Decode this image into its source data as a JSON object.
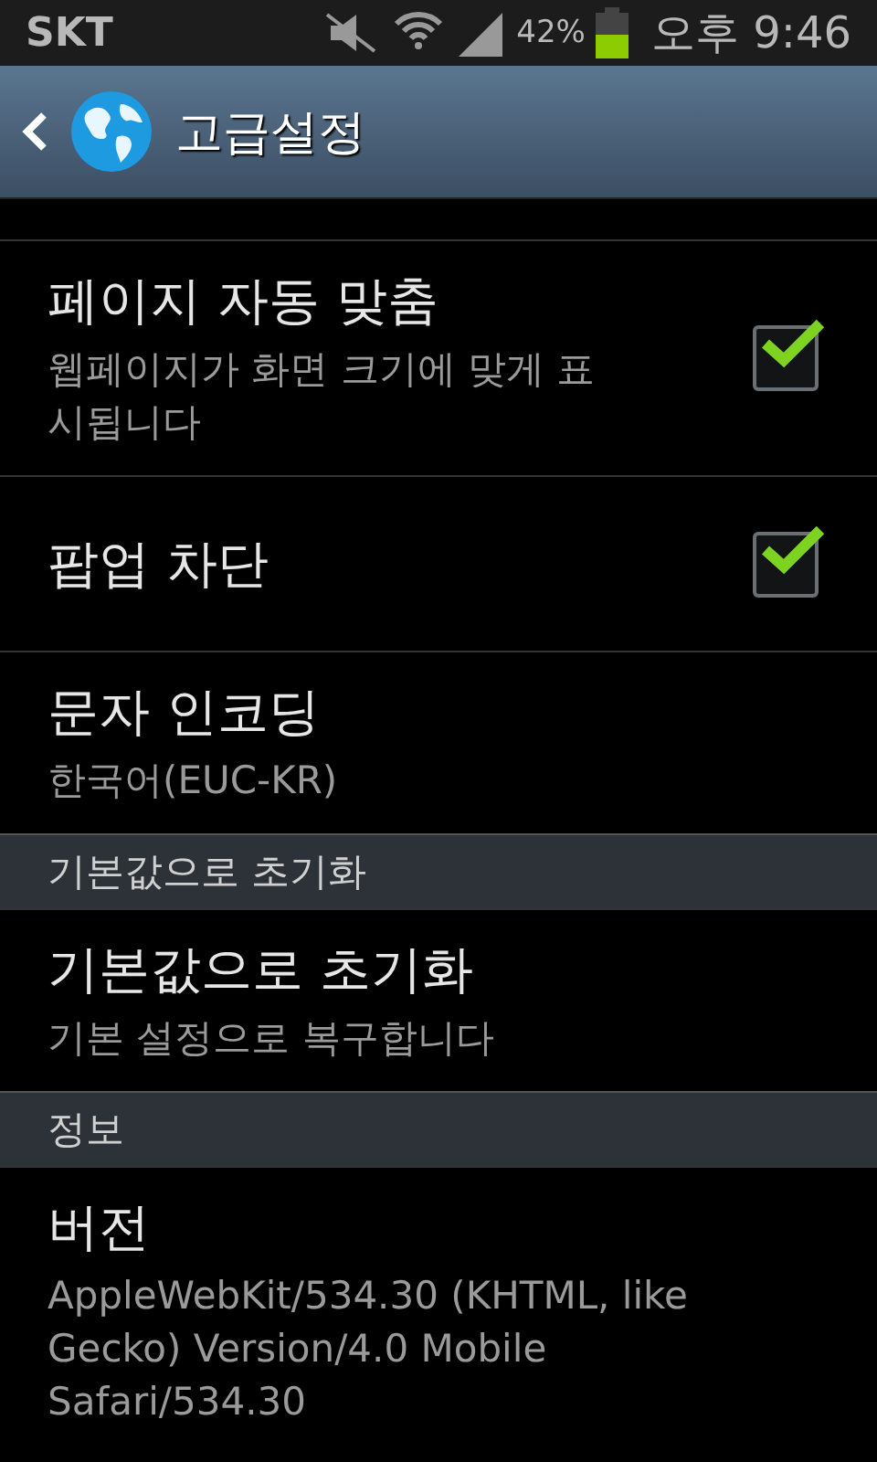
{
  "status_bar": {
    "carrier": "SKT",
    "battery_percent": "42%",
    "time": "오후 9:46"
  },
  "header": {
    "title": "고급설정"
  },
  "items": [
    {
      "kind": "checkbox",
      "title": "페이지 자동 맞춤",
      "summary": "웹페이지가 화면 크기에 맞게 표시됩니다",
      "checked": true
    },
    {
      "kind": "checkbox",
      "title": "팝업 차단",
      "checked": true
    },
    {
      "kind": "text",
      "title": "문자 인코딩",
      "summary": "한국어(EUC-KR)"
    },
    {
      "kind": "section",
      "title": "기본값으로 초기화"
    },
    {
      "kind": "text",
      "title": "기본값으로 초기화",
      "summary": "기본 설정으로 복구합니다"
    },
    {
      "kind": "section",
      "title": "정보"
    },
    {
      "kind": "text",
      "title": "버전",
      "summary": "AppleWebKit/534.30 (KHTML, like Gecko) Version/4.0 Mobile Safari/534.30"
    }
  ]
}
